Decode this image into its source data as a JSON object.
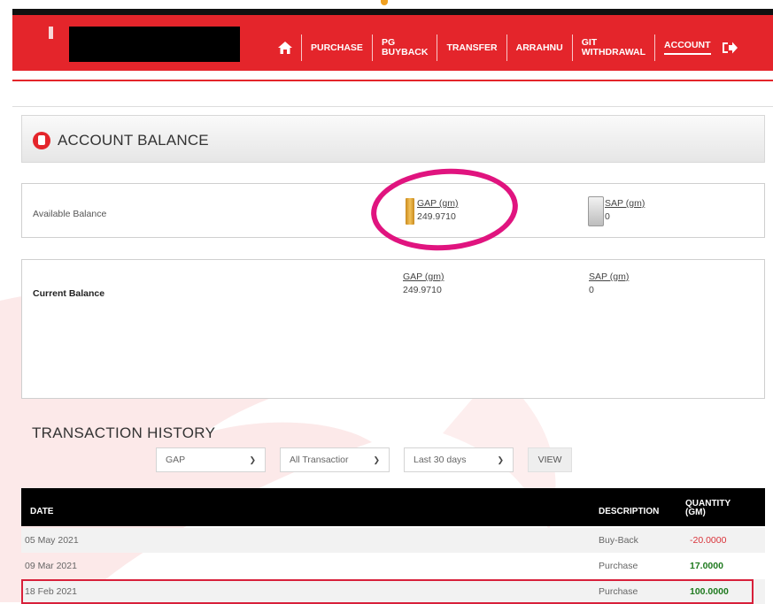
{
  "nav": {
    "items": [
      "PURCHASE",
      "PG\nBUYBACK",
      "TRANSFER",
      "ARRAHNU",
      "GIT\nWITHDRAWAL",
      "ACCOUNT"
    ]
  },
  "account": {
    "title": "ACCOUNT BALANCE"
  },
  "available": {
    "label": "Available Balance",
    "gap_label": "GAP (gm)",
    "gap_value": "249.9710",
    "sap_label": "SAP (gm)",
    "sap_value": "0"
  },
  "current": {
    "label": "Current Balance",
    "gap_label": "GAP (gm)",
    "gap_value": "249.9710",
    "sap_label": "SAP (gm)",
    "sap_value": "0"
  },
  "history": {
    "title": "TRANSACTION HISTORY",
    "filters": {
      "metal": "GAP",
      "type": "All Transactior",
      "period": "Last 30 days"
    },
    "view_label": "VIEW",
    "columns": {
      "date": "DATE",
      "description": "DESCRIPTION",
      "quantity": "QUANTITY\n(gm)"
    },
    "rows": [
      {
        "date": "05 May 2021",
        "description": "Buy-Back",
        "quantity": "-20.0000"
      },
      {
        "date": "09 Mar 2021",
        "description": "Purchase",
        "quantity": "17.0000"
      },
      {
        "date": "18 Feb 2021",
        "description": "Purchase",
        "quantity": "100.0000"
      }
    ]
  },
  "colors": {
    "brand": "#e4252b",
    "positive": "#1f7a1f",
    "negative": "#d9333a",
    "highlight_circle": "#e0147f"
  }
}
